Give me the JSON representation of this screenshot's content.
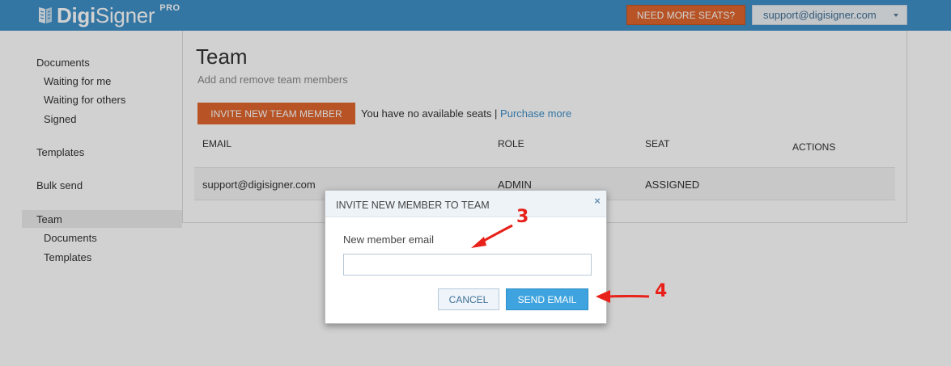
{
  "header": {
    "logo_bold": "Digi",
    "logo_rest": "Signer",
    "logo_badge": "PRO",
    "seats_button": "NEED MORE SEATS?",
    "account_email": "support@digisigner.com"
  },
  "sidebar": {
    "items": [
      {
        "label": "Documents",
        "level": "top"
      },
      {
        "label": "Waiting for me",
        "level": "sub"
      },
      {
        "label": "Waiting for others",
        "level": "sub"
      },
      {
        "label": "Signed",
        "level": "sub"
      },
      {
        "label": "Templates",
        "level": "top"
      },
      {
        "label": "Bulk send",
        "level": "top"
      },
      {
        "label": "Team",
        "level": "top",
        "active": true
      },
      {
        "label": "Documents",
        "level": "sub"
      },
      {
        "label": "Templates",
        "level": "sub"
      }
    ]
  },
  "main": {
    "title": "Team",
    "subtitle": "Add and remove team members",
    "invite_button": "INVITE NEW TEAM MEMBER",
    "seats_text": "You have no available seats |",
    "purchase_link": "Purchase more",
    "table": {
      "headers": [
        "EMAIL",
        "ROLE",
        "SEAT",
        "ACTIONS"
      ],
      "rows": [
        [
          "support@digisigner.com",
          "ADMIN",
          "ASSIGNED",
          ""
        ]
      ]
    }
  },
  "modal": {
    "title": "INVITE NEW MEMBER TO TEAM",
    "close_glyph": "×",
    "email_label": "New member email",
    "email_value": "",
    "cancel_button": "CANCEL",
    "send_button": "SEND EMAIL"
  },
  "annotations": {
    "step_3": "3",
    "step_4": "4",
    "arrow_color": "#e8211a"
  },
  "colors": {
    "header_bg": "#3f8fc7",
    "accent_orange": "#e0662e",
    "primary_blue": "#3ea3de",
    "link": "#3f8fc7"
  }
}
